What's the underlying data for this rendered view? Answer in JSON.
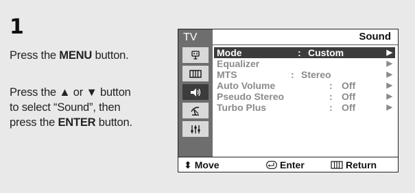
{
  "step": {
    "number": "1"
  },
  "instructions": {
    "line1": {
      "pre": "Press the ",
      "bold": "MENU",
      "post": " button."
    },
    "line2": {
      "pre": "Press the ▲ or ▼ button",
      "mid": "to select “Sound”, then",
      "pre3": "press the ",
      "bold": "ENTER",
      "post": " button."
    }
  },
  "osd": {
    "sidebar_label": "TV",
    "title": "Sound",
    "sidebar_icons": [
      "input-icon",
      "picture-icon",
      "sound-icon",
      "channel-icon",
      "setup-icon"
    ],
    "active_icon": "sound-icon",
    "menu": [
      {
        "label": "Mode",
        "sep": ":",
        "value": "Custom",
        "selected": true
      },
      {
        "label": "Equalizer",
        "sep": "",
        "value": "",
        "selected": false
      },
      {
        "label": "MTS",
        "sep": ":",
        "value": "Stereo",
        "selected": false
      },
      {
        "label": "Auto Volume",
        "sep": ":",
        "value": "Off",
        "selected": false
      },
      {
        "label": "Pseudo Stereo",
        "sep": ":",
        "value": "Off",
        "selected": false
      },
      {
        "label": "Turbo Plus",
        "sep": ":",
        "value": "Off",
        "selected": false
      }
    ],
    "arrow": "▶",
    "footer": {
      "move": "Move",
      "enter": "Enter",
      "return": "Return"
    }
  }
}
